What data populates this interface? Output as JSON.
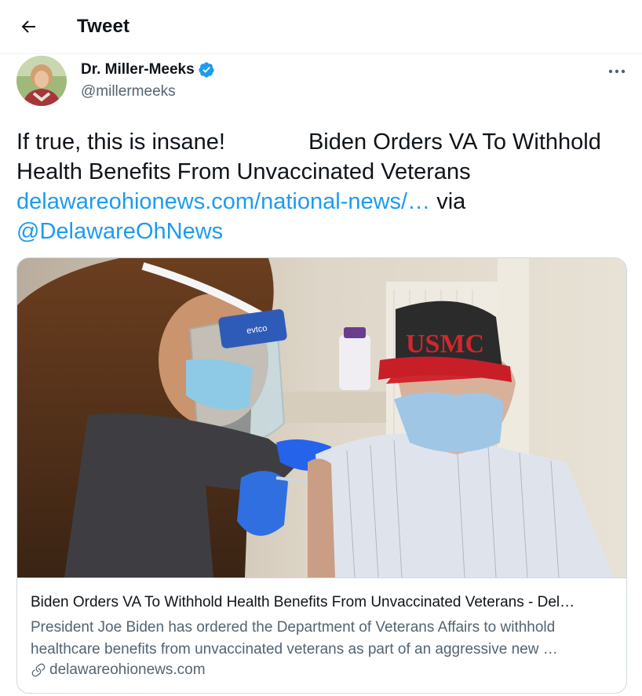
{
  "header": {
    "title": "Tweet",
    "back_icon": "arrow-left-icon"
  },
  "tweet": {
    "author_name": "Dr. Miller-Meeks",
    "handle": "@millermeeks",
    "verified": true,
    "text_intro": "If true, this is insane!",
    "text_headline": "Biden Orders VA To Withhold Health Benefits From Unvaccinated Veterans",
    "link_url": "delawareohionews.com/national-news/…",
    "via_word": "via",
    "mention": "@DelawareOhNews",
    "more_icon": "more-horizontal-icon"
  },
  "card": {
    "image_desc": "healthcare worker with face shield vaccinating veteran in USMC cap",
    "cap_text": "USMC",
    "shield_text": "evtco",
    "title": "Biden Orders VA To Withhold Health Benefits From Unvaccinated Veterans - Del…",
    "description": "President Joe Biden has ordered the Department of Veterans Affairs to withhold healthcare benefits from unvaccinated veterans as part of an aggressive new …",
    "domain": "delawareohionews.com",
    "domain_icon": "link-icon"
  },
  "colors": {
    "link": "#1d9bf0",
    "secondary_text": "#536471",
    "border": "#cfd9de",
    "verified_badge": "#1d9bf0"
  }
}
